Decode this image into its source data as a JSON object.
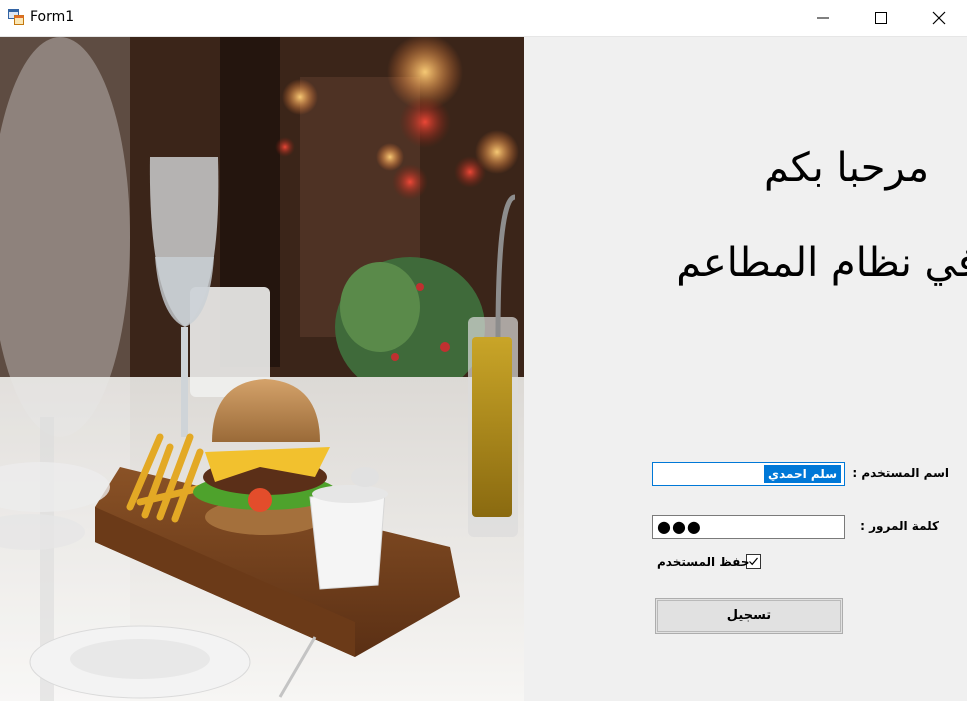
{
  "window": {
    "title": "Form1",
    "icon": "form-app-icon",
    "controls": [
      "minimize-icon",
      "maximize-icon",
      "close-icon"
    ]
  },
  "hero_image": {
    "subject": "burger-and-fries-restaurant-photo"
  },
  "welcome": {
    "line1": "مرحبا بكم",
    "line2": "في نظام المطاعم"
  },
  "form": {
    "username_label": "اسم المستخدم :",
    "username_value": "سلم احمدي",
    "password_label": "كلمة المرور :",
    "password_value": "●●●",
    "remember_label": "حفظ المستخدم",
    "remember_checked": true,
    "login_label": "تسجيل"
  },
  "colors": {
    "selection": "#0078d7",
    "background": "#f0f0f0"
  }
}
